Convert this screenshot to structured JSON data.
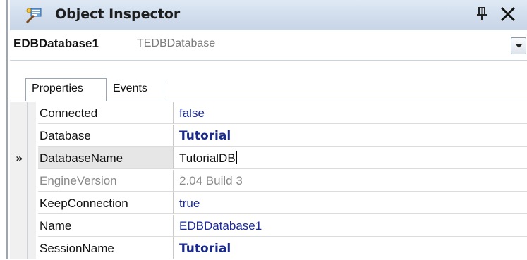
{
  "titlebar": {
    "title": "Object Inspector",
    "icons": [
      "object-inspector-icon",
      "pin-icon",
      "close-icon"
    ]
  },
  "selector": {
    "component_name": "EDBDatabase1",
    "component_type": "TEDBDatabase",
    "dropdown_icon": "chevron-down-icon"
  },
  "tabs": [
    {
      "label": "Properties",
      "active": true
    },
    {
      "label": "Events",
      "active": false
    }
  ],
  "current_row_marker": "»",
  "properties": [
    {
      "name": "Connected",
      "value": "false",
      "style": "normal"
    },
    {
      "name": "Database",
      "value": "Tutorial",
      "style": "bold"
    },
    {
      "name": "DatabaseName",
      "value": "TutorialDB",
      "style": "editing"
    },
    {
      "name": "EngineVersion",
      "value": "2.04 Build 3",
      "style": "readonly"
    },
    {
      "name": "KeepConnection",
      "value": "true",
      "style": "normal"
    },
    {
      "name": "Name",
      "value": "EDBDatabase1",
      "style": "normal"
    },
    {
      "name": "SessionName",
      "value": "Tutorial",
      "style": "bold"
    }
  ],
  "colors": {
    "titlebar": "#d0dcec",
    "value_text": "#1a2a9a",
    "readonly_text": "#8a8a8a"
  }
}
